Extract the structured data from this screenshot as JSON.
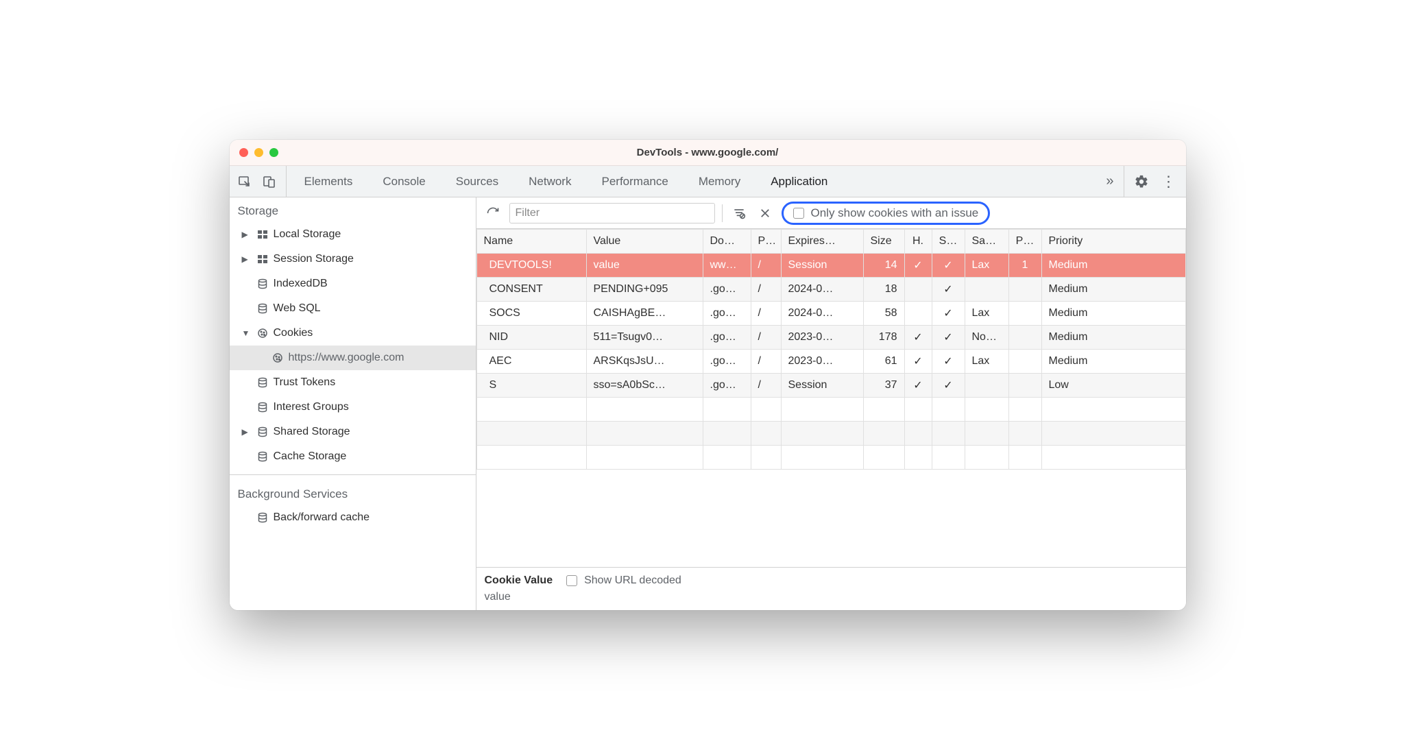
{
  "window_title": "DevTools - www.google.com/",
  "tabs": {
    "items": [
      "Elements",
      "Console",
      "Sources",
      "Network",
      "Performance",
      "Memory",
      "Application"
    ],
    "active": "Application",
    "overflow": "»"
  },
  "sidebar": {
    "storage_header": "Storage",
    "storage_items": [
      {
        "label": "Local Storage",
        "expandable": true,
        "icon": "grid"
      },
      {
        "label": "Session Storage",
        "expandable": true,
        "icon": "grid"
      },
      {
        "label": "IndexedDB",
        "expandable": false,
        "icon": "db"
      },
      {
        "label": "Web SQL",
        "expandable": false,
        "icon": "db"
      },
      {
        "label": "Cookies",
        "expandable": true,
        "expanded": true,
        "icon": "cookie",
        "children": [
          {
            "label": "https://www.google.com",
            "icon": "cookie",
            "selected": true
          }
        ]
      },
      {
        "label": "Trust Tokens",
        "expandable": false,
        "icon": "db"
      },
      {
        "label": "Interest Groups",
        "expandable": false,
        "icon": "db"
      },
      {
        "label": "Shared Storage",
        "expandable": true,
        "icon": "db"
      },
      {
        "label": "Cache Storage",
        "expandable": false,
        "icon": "db"
      }
    ],
    "bg_header": "Background Services",
    "bg_items": [
      {
        "label": "Back/forward cache",
        "icon": "db"
      }
    ]
  },
  "toolbar": {
    "filter_placeholder": "Filter",
    "only_issues_label": "Only show cookies with an issue"
  },
  "columns": [
    "Name",
    "Value",
    "Do…",
    "P…",
    "Expires…",
    "Size",
    "H.",
    "S…",
    "Sa…",
    "P…",
    "Priority"
  ],
  "rows": [
    {
      "name": "DEVTOOLS!",
      "value": "value",
      "domain": "ww…",
      "path": "/",
      "expires": "Session",
      "size": "14",
      "http": "✓",
      "secure": "✓",
      "samesite": "Lax",
      "partition": "1",
      "priority": "Medium",
      "selected": true
    },
    {
      "name": "CONSENT",
      "value": "PENDING+095",
      "domain": ".go…",
      "path": "/",
      "expires": "2024-0…",
      "size": "18",
      "http": "",
      "secure": "✓",
      "samesite": "",
      "partition": "",
      "priority": "Medium"
    },
    {
      "name": "SOCS",
      "value": "CAISHAgBE…",
      "domain": ".go…",
      "path": "/",
      "expires": "2024-0…",
      "size": "58",
      "http": "",
      "secure": "✓",
      "samesite": "Lax",
      "partition": "",
      "priority": "Medium"
    },
    {
      "name": "NID",
      "value": "511=Tsugv0…",
      "domain": ".go…",
      "path": "/",
      "expires": "2023-0…",
      "size": "178",
      "http": "✓",
      "secure": "✓",
      "samesite": "No…",
      "partition": "",
      "priority": "Medium"
    },
    {
      "name": "AEC",
      "value": "ARSKqsJsU…",
      "domain": ".go…",
      "path": "/",
      "expires": "2023-0…",
      "size": "61",
      "http": "✓",
      "secure": "✓",
      "samesite": "Lax",
      "partition": "",
      "priority": "Medium"
    },
    {
      "name": "S",
      "value": "sso=sA0bSc…",
      "domain": ".go…",
      "path": "/",
      "expires": "Session",
      "size": "37",
      "http": "✓",
      "secure": "✓",
      "samesite": "",
      "partition": "",
      "priority": "Low"
    }
  ],
  "detail": {
    "label": "Cookie Value",
    "decode_label": "Show URL decoded",
    "value": "value"
  }
}
